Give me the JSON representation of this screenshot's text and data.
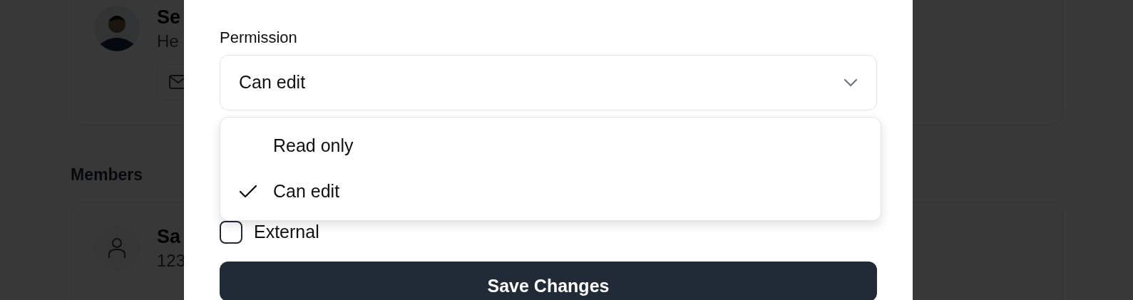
{
  "background": {
    "profile_card": {
      "name": "Se",
      "subtitle": "He"
    },
    "section_title": "Members",
    "member_card": {
      "name": "Sa",
      "subtitle": "123"
    }
  },
  "modal": {
    "field_label": "Permission",
    "select": {
      "value": "Can edit",
      "options": [
        {
          "label": "Read only",
          "selected": false
        },
        {
          "label": "Can edit",
          "selected": true
        }
      ]
    },
    "checkbox": {
      "label": "External",
      "checked": false
    },
    "button": "Save Changes"
  }
}
